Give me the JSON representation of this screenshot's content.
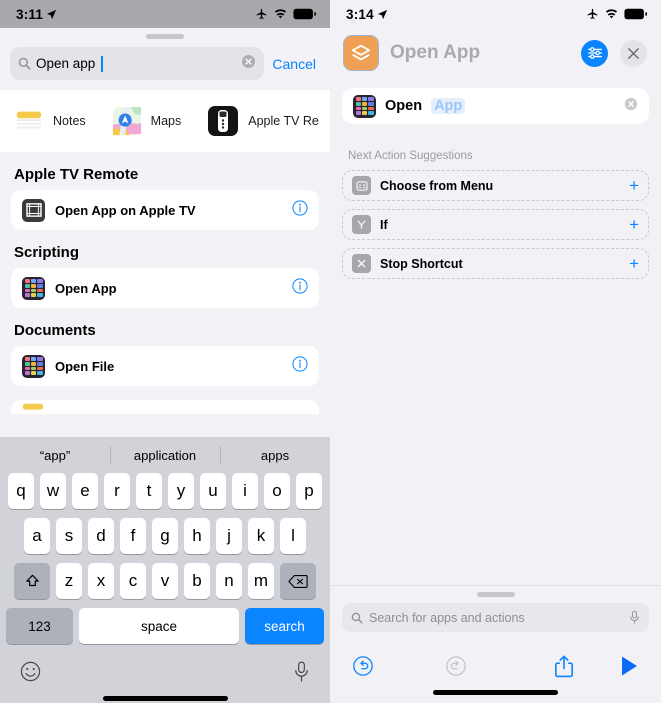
{
  "left": {
    "status": {
      "time": "3:11",
      "location_icon": "location-arrow-icon",
      "airplane_icon": "airplane-mode-icon",
      "wifi_icon": "wifi-icon",
      "battery_icon": "battery-icon"
    },
    "search": {
      "value": "Open app",
      "icon": "search-icon",
      "clear_icon": "clear-circle-icon",
      "cancel_label": "Cancel"
    },
    "app_row": [
      {
        "label": "Notes",
        "icon": "notes-app-icon"
      },
      {
        "label": "Maps",
        "icon": "maps-app-icon"
      },
      {
        "label": "Apple TV Re",
        "icon": "apple-tv-remote-app-icon"
      }
    ],
    "sections": [
      {
        "title": "Apple TV Remote",
        "items": [
          {
            "name": "Open App on Apple TV",
            "icon": "apple-tv-frame-icon",
            "info_icon": "info-circle-icon"
          }
        ]
      },
      {
        "title": "Scripting",
        "items": [
          {
            "name": "Open App",
            "icon": "app-grid-icon",
            "info_icon": "info-circle-icon"
          }
        ]
      },
      {
        "title": "Documents",
        "items": [
          {
            "name": "Open File",
            "icon": "app-grid-icon",
            "info_icon": "info-circle-icon"
          }
        ]
      }
    ],
    "keyboard": {
      "suggestions": [
        "“app”",
        "application",
        "apps"
      ],
      "row1": [
        "q",
        "w",
        "e",
        "r",
        "t",
        "y",
        "u",
        "i",
        "o",
        "p"
      ],
      "row2": [
        "a",
        "s",
        "d",
        "f",
        "g",
        "h",
        "j",
        "k",
        "l"
      ],
      "row3": [
        "z",
        "x",
        "c",
        "v",
        "b",
        "n",
        "m"
      ],
      "shift_icon": "shift-arrow-icon",
      "backspace_icon": "backspace-icon",
      "numbers_label": "123",
      "space_label": "space",
      "search_label": "search",
      "emoji_icon": "emoji-smiley-icon",
      "dictation_icon": "microphone-icon"
    }
  },
  "right": {
    "status": {
      "time": "3:14",
      "location_icon": "location-arrow-icon",
      "airplane_icon": "airplane-mode-icon",
      "wifi_icon": "wifi-icon",
      "battery_icon": "battery-icon"
    },
    "header": {
      "app_icon": "shortcuts-app-icon",
      "title": "Open App",
      "settings_icon": "sliders-icon",
      "close_icon": "close-x-icon"
    },
    "action": {
      "icon": "app-grid-icon",
      "name": "Open",
      "parameter": "App",
      "clear_icon": "clear-circle-icon"
    },
    "suggestions_title": "Next Action Suggestions",
    "suggestions": [
      {
        "label": "Choose from Menu",
        "icon": "menu-list-icon",
        "add_icon": "plus-icon"
      },
      {
        "label": "If",
        "icon": "branch-icon",
        "add_icon": "plus-icon"
      },
      {
        "label": "Stop Shortcut",
        "icon": "stop-x-icon",
        "add_icon": "plus-icon"
      }
    ],
    "bottom": {
      "search_placeholder": "Search for apps and actions",
      "search_icon": "search-icon",
      "mic_icon": "microphone-icon",
      "undo_icon": "undo-icon",
      "redo_icon": "redo-icon",
      "share_icon": "share-icon",
      "play_icon": "play-icon"
    }
  },
  "colors": {
    "accent": "#0a84ff",
    "shortcut_orange": "#efa055",
    "param_blue": "#9cc6f5"
  }
}
